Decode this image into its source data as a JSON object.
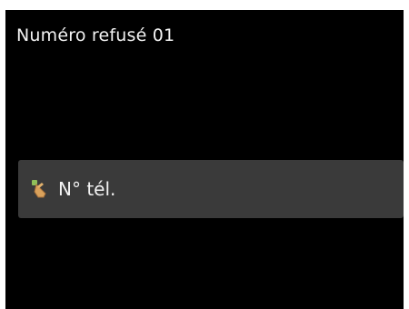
{
  "screen": {
    "title": "Numéro refusé 01",
    "items": [
      {
        "label": "N° tél.",
        "icon": "hand-touch-icon"
      }
    ]
  },
  "colors": {
    "background": "#000000",
    "item_background": "#3a3a3a",
    "text": "#f2f2f2"
  }
}
